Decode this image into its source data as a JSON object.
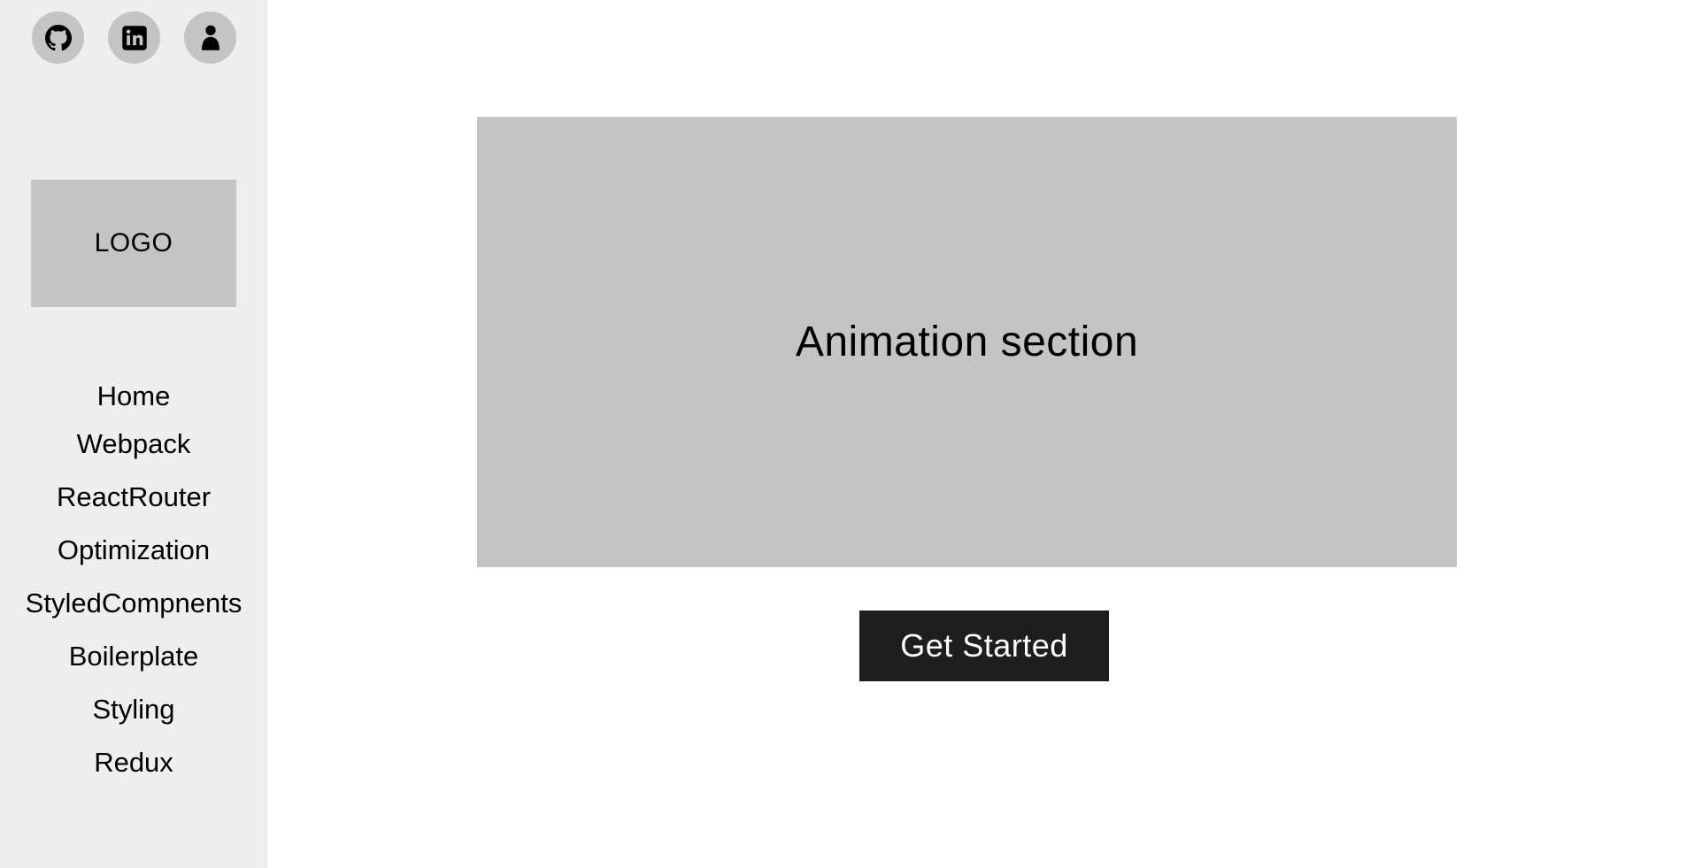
{
  "sidebar": {
    "social": [
      {
        "icon": "github-icon"
      },
      {
        "icon": "linkedin-icon"
      },
      {
        "icon": "person-icon"
      }
    ],
    "logo": "LOGO",
    "nav": [
      {
        "label": "Home"
      },
      {
        "label": "Webpack"
      },
      {
        "label": "ReactRouter"
      },
      {
        "label": "Optimization"
      },
      {
        "label": "StyledCompnents"
      },
      {
        "label": "Boilerplate"
      },
      {
        "label": "Styling"
      },
      {
        "label": "Redux"
      }
    ]
  },
  "main": {
    "hero_text": "Animation section",
    "cta_label": "Get Started"
  },
  "colors": {
    "sidebar_bg": "#eeeeee",
    "placeholder_gray": "#c4c4c4",
    "button_bg": "#1e1e1e",
    "button_text": "#ffffff"
  }
}
